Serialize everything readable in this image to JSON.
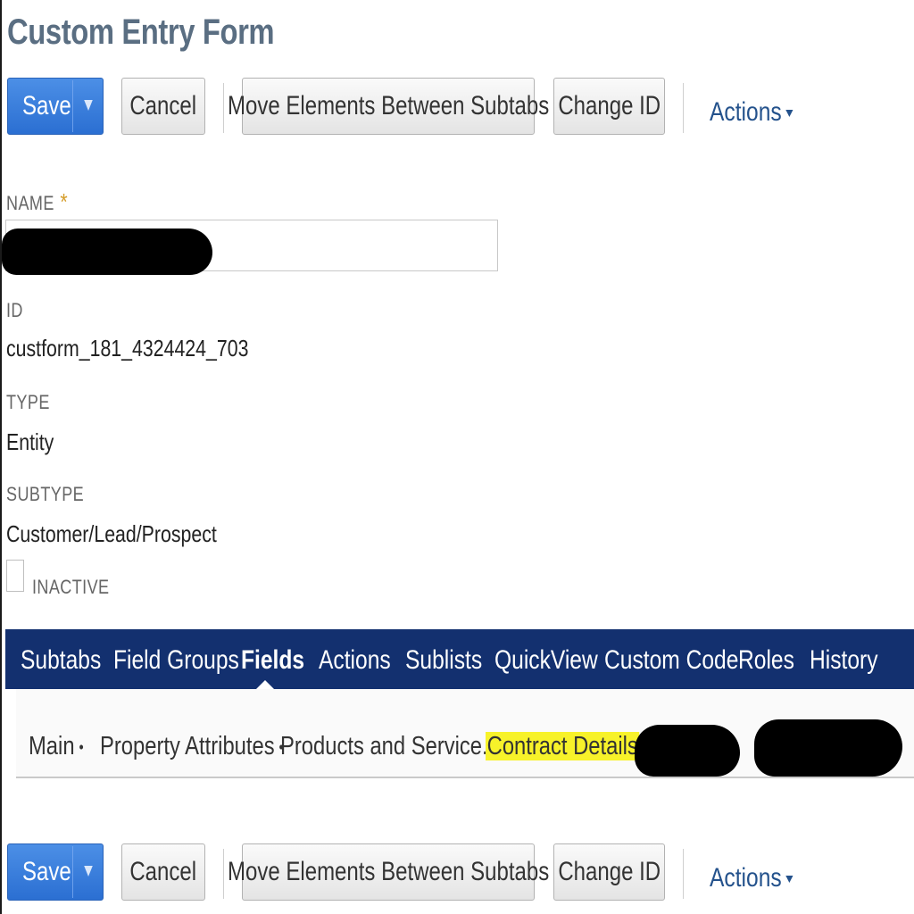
{
  "page": {
    "title": "Custom Entry Form"
  },
  "toolbar": {
    "save_label": "Save",
    "save_menu_icon": "caret-down-icon",
    "cancel_label": "Cancel",
    "move_label": "Move Elements Between Subtabs",
    "change_id_label": "Change ID",
    "actions_label": "Actions"
  },
  "fields": {
    "name_label": "NAME",
    "name_required_mark": "*",
    "id_label": "ID",
    "id_value": "custform_181_4324424_703",
    "type_label": "TYPE",
    "type_value": "Entity",
    "subtype_label": "SUBTYPE",
    "subtype_value": "Customer/Lead/Prospect",
    "inactive_label": "INACTIVE"
  },
  "tabs": [
    {
      "label": "Subtabs",
      "active": false
    },
    {
      "label": "Field Groups",
      "active": false
    },
    {
      "label": "Fields",
      "active": true
    },
    {
      "label": "Actions",
      "active": false
    },
    {
      "label": "Sublists",
      "active": false
    },
    {
      "label": "QuickView",
      "active": false
    },
    {
      "label": "Custom Code",
      "active": false
    },
    {
      "label": "Roles",
      "active": false
    },
    {
      "label": "History",
      "active": false
    }
  ],
  "subtabs": [
    {
      "label": "Main",
      "dot": "•"
    },
    {
      "label": "Property Attributes",
      "dot": "•"
    },
    {
      "label": "Products and Service...",
      "dot": "•"
    },
    {
      "label": "Contract Details",
      "dot": "•",
      "highlighted": true
    }
  ],
  "colors": {
    "title": "#5a6e82",
    "primary_button": "#2b6fd2",
    "tab_bar": "#13306f",
    "link": "#24528c",
    "highlight": "#f7f22a",
    "required": "#d59d2a"
  }
}
